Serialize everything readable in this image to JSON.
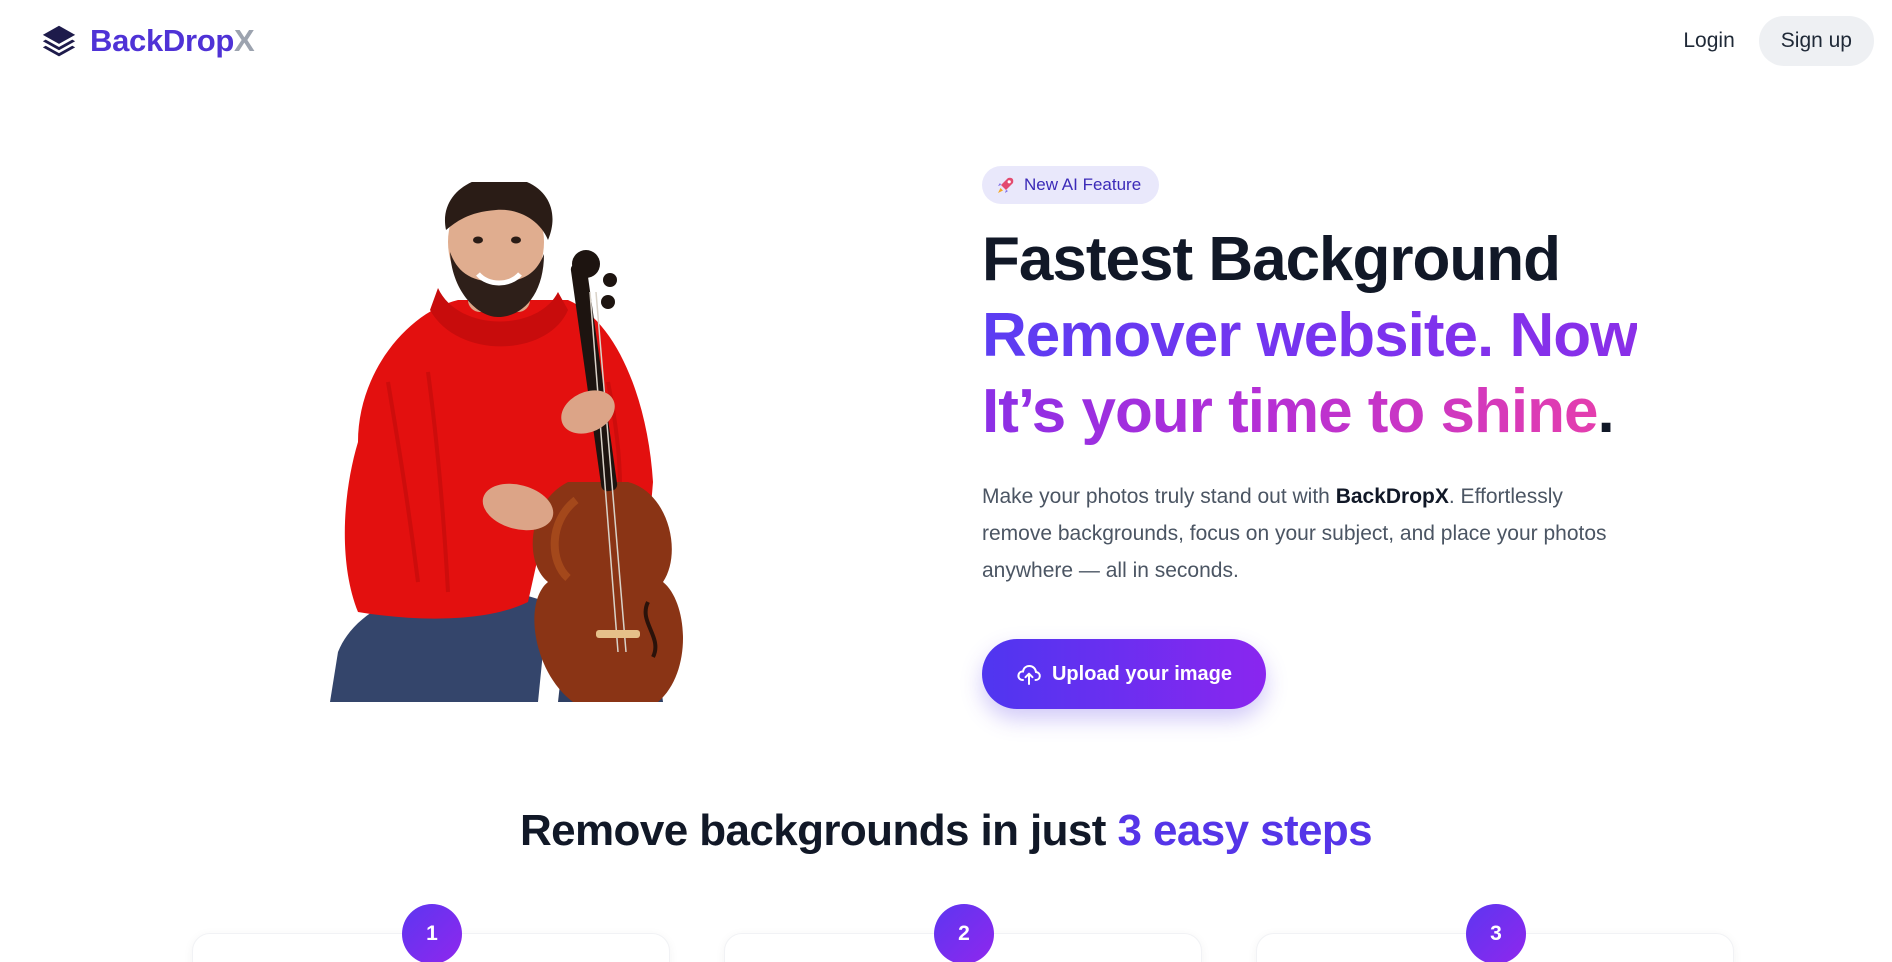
{
  "header": {
    "brand_main": "BackDrop",
    "brand_x": "X",
    "brand_icon": "stacked-layers-icon",
    "login_label": "Login",
    "signup_label": "Sign up"
  },
  "hero": {
    "badge_icon": "rocket-icon",
    "badge_label": "New AI Feature",
    "headline": {
      "line1": "Fastest Background",
      "line2": "Remover website. Now",
      "line3_gradient": "It’s your time to shine",
      "line3_end": "."
    },
    "description": {
      "before": "Make your photos truly stand out with ",
      "brand": "BackDropX",
      "after": ". Effortlessly remove backgrounds, focus on your subject, and place your photos anywhere — all in seconds."
    },
    "upload_icon": "cloud-upload-icon",
    "upload_label": "Upload your image",
    "photo": "person-with-cello-cutout"
  },
  "steps": {
    "title_before": "Remove backgrounds in just ",
    "title_accent": "3 easy steps",
    "numbers": [
      "1",
      "2",
      "3"
    ]
  },
  "colors": {
    "brand": "#4f32d6",
    "accent_start": "#5b3df2",
    "accent_end": "#e43eae"
  }
}
